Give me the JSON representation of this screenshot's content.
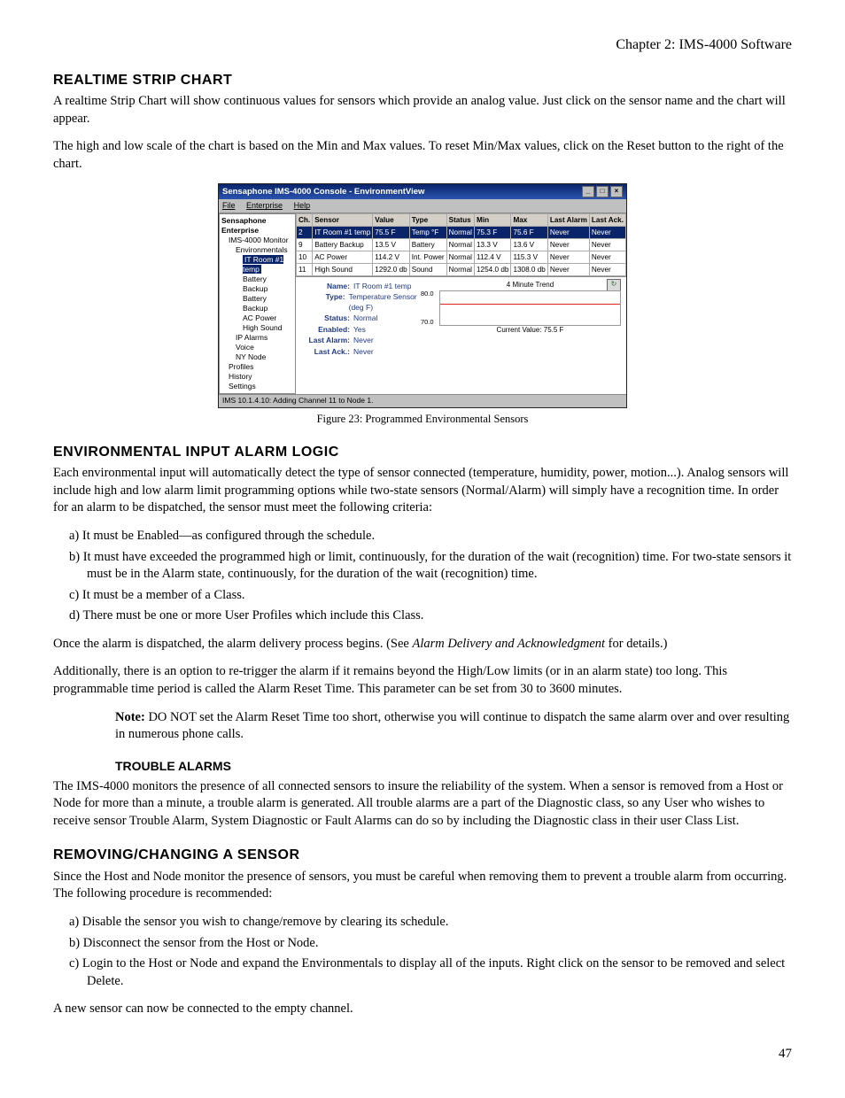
{
  "header": {
    "chapter": "Chapter 2: IMS-4000 Software"
  },
  "page_number": "47",
  "sections": {
    "realtime": {
      "title": "REALTIME STRIP CHART",
      "p1": "A realtime Strip Chart will show continuous values for sensors which provide an analog value. Just click on the sensor name and the chart will appear.",
      "p2": "The high and low scale of the chart is based on the Min and Max values. To reset Min/Max values, click on the Reset button to the right of the chart."
    },
    "figure23_caption": "Figure 23: Programmed Environmental Sensors",
    "envlogic": {
      "title": "ENVIRONMENTAL INPUT ALARM LOGIC",
      "p1": "Each environmental input will automatically detect the type of sensor connected (temperature, humidity, power, motion...). Analog sensors will include high and low alarm limit programming options while two-state sensors (Normal/Alarm) will simply have a recognition time. In order for an alarm to be dispatched, the sensor must meet the following criteria:",
      "a": "a) It must be Enabled—as configured through the schedule.",
      "b": "b) It must have exceeded the programmed high or limit, continuously, for the duration of the wait (recognition) time. For two-state sensors it must be in the Alarm state, continuously, for the duration of the wait (recognition) time.",
      "c": "c) It must be a member of a Class.",
      "d": "d) There must be one or more User Profiles which include this Class.",
      "p2a": "Once the alarm is dispatched, the alarm delivery process begins. (See ",
      "p2i": "Alarm Delivery and Acknowledgment",
      "p2b": " for details.)",
      "p3": "Additionally, there is an option to re-trigger the alarm if it remains beyond the High/Low limits (or in an alarm state) too long. This programmable time period is called the Alarm Reset Time. This parameter can be set from 30 to 3600 minutes.",
      "note_label": "Note:",
      "note_body": " DO NOT set the Alarm Reset Time too short, otherwise you will continue to dispatch the same alarm over and over resulting in numerous phone calls."
    },
    "trouble": {
      "title": "TROUBLE ALARMS",
      "p1": "The IMS-4000 monitors the presence of all connected sensors to insure the reliability of the system. When a sensor is removed from a Host or Node for more than a minute, a trouble alarm is generated. All trouble alarms are a part of the Diagnostic class, so any User who wishes to receive sensor Trouble Alarm, System Diagnostic or Fault Alarms can do so by including the Diagnostic class in their user Class List."
    },
    "removing": {
      "title": "REMOVING/CHANGING A SENSOR",
      "p1": "Since the Host and Node monitor the presence of sensors, you must be careful when removing them to prevent a trouble alarm from occurring. The following procedure is recommended:",
      "a": "a) Disable the sensor you wish to change/remove by clearing its schedule.",
      "b": "b) Disconnect the sensor from the Host or Node.",
      "c": "c) Login to the Host or Node and expand the Environmentals to display all of the inputs. Right click on the sensor to be removed and select Delete.",
      "p2": "A new sensor can now be connected to the empty channel."
    }
  },
  "window": {
    "title": "Sensaphone IMS-4000 Console - EnvironmentView",
    "menus": [
      "File",
      "Enterprise",
      "Help"
    ],
    "tree": {
      "root": "Sensaphone Enterprise",
      "items": [
        "IMS-4000 Monitor",
        "Environmentals",
        "IT Room #1 temp",
        "Battery Backup",
        "Battery Backup",
        "AC Power",
        "High Sound",
        "IP Alarms",
        "Voice",
        "NY Node",
        "Profiles",
        "History",
        "Settings"
      ]
    },
    "columns": [
      "Ch.",
      "Sensor",
      "Value",
      "Type",
      "Status",
      "Min",
      "Max",
      "Last Alarm",
      "Last Ack."
    ],
    "rows": [
      {
        "ch": "2",
        "sensor": "IT Room #1 temp",
        "value": "75.5 F",
        "type": "Temp °F",
        "status": "Normal",
        "min": "75.3 F",
        "max": "75.6 F",
        "la": "Never",
        "lk": "Never",
        "sel": true
      },
      {
        "ch": "9",
        "sensor": "Battery Backup",
        "value": "13.5 V",
        "type": "Battery",
        "status": "Normal",
        "min": "13.3 V",
        "max": "13.6 V",
        "la": "Never",
        "lk": "Never"
      },
      {
        "ch": "10",
        "sensor": "AC Power",
        "value": "114.2 V",
        "type": "Int. Power",
        "status": "Normal",
        "min": "112.4 V",
        "max": "115.3 V",
        "la": "Never",
        "lk": "Never"
      },
      {
        "ch": "11",
        "sensor": "High Sound",
        "value": "1292.0 db",
        "type": "Sound",
        "status": "Normal",
        "min": "1254.0 db",
        "max": "1308.0 db",
        "la": "Never",
        "lk": "Never"
      }
    ],
    "detail": {
      "name_lbl": "Name:",
      "name_val": "IT Room #1 temp",
      "type_lbl": "Type:",
      "type_val": "Temperature Sensor (deg F)",
      "status_lbl": "Status:",
      "status_val": "Normal",
      "enabled_lbl": "Enabled:",
      "enabled_val": "Yes",
      "lastalarm_lbl": "Last Alarm:",
      "lastalarm_val": "Never",
      "lastack_lbl": "Last Ack.:",
      "lastack_val": "Never"
    },
    "trend_title": "4 Minute Trend",
    "trend_hi": "80.0",
    "trend_lo": "70.0",
    "trend_caption": "Current Value: 75.5 F",
    "reset_glyph": "↻",
    "status_bar": "IMS 10.1.4.10: Adding Channel 11 to Node 1."
  }
}
